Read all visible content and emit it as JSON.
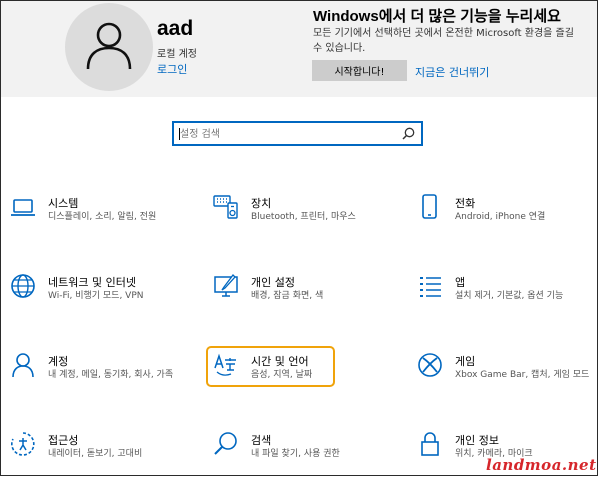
{
  "account": {
    "name": "aad",
    "type": "로컬 계정",
    "signin_label": "로그인"
  },
  "promo": {
    "title": "Windows에서 더 많은 기능을 누리세요",
    "description": "모든 기기에서 선택하던 곳에서 온전한 Microsoft 환경을 즐길 수 있습니다.",
    "start_label": "시작합니다!",
    "skip_label": "지금은 건너뛰기"
  },
  "search": {
    "placeholder": "설정 검색"
  },
  "categories": [
    {
      "title": "시스템",
      "desc": "디스플레이, 소리, 알림, 전원",
      "icon": "laptop-icon"
    },
    {
      "title": "장치",
      "desc": "Bluetooth, 프린터, 마우스",
      "icon": "keyboard-icon"
    },
    {
      "title": "전화",
      "desc": "Android, iPhone 연결",
      "icon": "phone-icon"
    },
    {
      "title": "네트워크 및 인터넷",
      "desc": "Wi-Fi, 비행기 모드, VPN",
      "icon": "globe-icon"
    },
    {
      "title": "개인 설정",
      "desc": "배경, 잠금 화면, 색",
      "icon": "personalization-icon"
    },
    {
      "title": "앱",
      "desc": "설치 제거, 기본값, 옵션 기능",
      "icon": "apps-icon"
    },
    {
      "title": "계정",
      "desc": "내 계정, 메일, 동기화, 회사, 가족",
      "icon": "person-icon"
    },
    {
      "title": "시간 및 언어",
      "desc": "음성, 지역, 날짜",
      "icon": "time-language-icon"
    },
    {
      "title": "게임",
      "desc": "Xbox Game Bar, 캡처, 게임 모드",
      "icon": "xbox-icon"
    },
    {
      "title": "접근성",
      "desc": "내레이터, 돋보기, 고대비",
      "icon": "accessibility-icon"
    },
    {
      "title": "검색",
      "desc": "내 파일 찾기, 사용 권한",
      "icon": "search-icon"
    },
    {
      "title": "개인 정보",
      "desc": "위치, 카메라, 마이크",
      "icon": "lock-icon"
    }
  ],
  "colors": {
    "accent": "#0067c0",
    "highlight": "#f0a30a",
    "watermark": "#d6262b"
  },
  "watermark": "landmoa.net"
}
